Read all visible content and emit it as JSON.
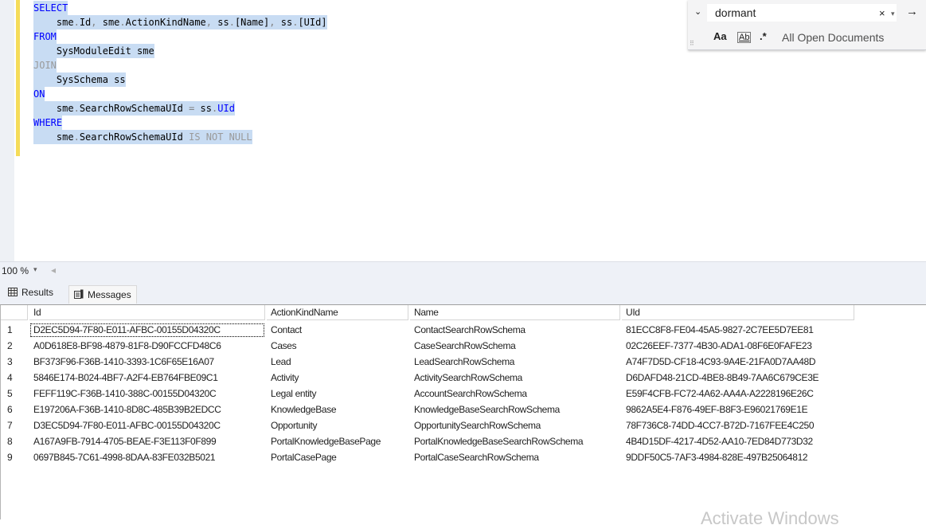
{
  "editor": {
    "lines": [
      {
        "tokens": [
          {
            "t": "SELECT",
            "c": "kw"
          }
        ]
      },
      {
        "tokens": [
          {
            "t": "    sme",
            "c": "ident"
          },
          {
            "t": ".",
            "c": "op"
          },
          {
            "t": "Id",
            "c": "ident"
          },
          {
            "t": ", ",
            "c": "op"
          },
          {
            "t": "sme",
            "c": "ident"
          },
          {
            "t": ".",
            "c": "op"
          },
          {
            "t": "ActionKindName",
            "c": "ident"
          },
          {
            "t": ", ",
            "c": "op"
          },
          {
            "t": "ss",
            "c": "ident"
          },
          {
            "t": ".",
            "c": "op"
          },
          {
            "t": "[Name]",
            "c": "ident"
          },
          {
            "t": ", ",
            "c": "op"
          },
          {
            "t": "ss",
            "c": "ident"
          },
          {
            "t": ".",
            "c": "op"
          },
          {
            "t": "[UId]",
            "c": "ident"
          }
        ]
      },
      {
        "tokens": [
          {
            "t": "FROM",
            "c": "kw"
          }
        ]
      },
      {
        "tokens": [
          {
            "t": "    SysModuleEdit sme",
            "c": "ident"
          }
        ]
      },
      {
        "tokens": [
          {
            "t": "JOIN",
            "c": "grey"
          }
        ]
      },
      {
        "tokens": [
          {
            "t": "    SysSchema ss",
            "c": "ident"
          }
        ]
      },
      {
        "tokens": [
          {
            "t": "ON",
            "c": "kw"
          }
        ]
      },
      {
        "tokens": [
          {
            "t": "    sme",
            "c": "ident"
          },
          {
            "t": ".",
            "c": "op"
          },
          {
            "t": "SearchRowSchemaUId ",
            "c": "ident"
          },
          {
            "t": "=",
            "c": "op"
          },
          {
            "t": " ss",
            "c": "ident"
          },
          {
            "t": ".",
            "c": "op"
          },
          {
            "t": "UId",
            "c": "kw"
          }
        ]
      },
      {
        "tokens": [
          {
            "t": "WHERE",
            "c": "kw"
          }
        ]
      },
      {
        "tokens": [
          {
            "t": "    sme",
            "c": "ident"
          },
          {
            "t": ".",
            "c": "op"
          },
          {
            "t": "SearchRowSchemaUId ",
            "c": "ident"
          },
          {
            "t": "IS NOT NULL",
            "c": "grey"
          }
        ]
      }
    ]
  },
  "find": {
    "term": "dormant",
    "clear_icon": "×",
    "dropdown_icon": "▾",
    "next_icon": "→",
    "chevron_icon": "⌄",
    "match_case": "Aa",
    "whole_word": "Ab",
    "regex": ".*",
    "scope": "All Open Documents",
    "grip_icon": "⠿"
  },
  "zoom": {
    "level": "100 %",
    "dropdown_icon": "▾",
    "scroll_left_icon": "◂"
  },
  "tabs": {
    "results": "Results",
    "messages": "Messages"
  },
  "results": {
    "columns": [
      "",
      "Id",
      "ActionKindName",
      "Name",
      "UId"
    ],
    "rows": [
      [
        "1",
        "D2EC5D94-7F80-E011-AFBC-00155D04320C",
        "Contact",
        "ContactSearchRowSchema",
        "81ECC8F8-FE04-45A5-9827-2C7EE5D7EE81"
      ],
      [
        "2",
        "A0D618E8-BF98-4879-81F8-D90FCCFD48C6",
        "Cases",
        "CaseSearchRowSchema",
        "02C26EEF-7377-4B30-ADA1-08F6E0FAFE23"
      ],
      [
        "3",
        "BF373F96-F36B-1410-3393-1C6F65E16A07",
        "Lead",
        "LeadSearchRowSchema",
        "A74F7D5D-CF18-4C93-9A4E-21FA0D7AA48D"
      ],
      [
        "4",
        "5846E174-B024-4BF7-A2F4-EB764FBE09C1",
        "Activity",
        "ActivitySearchRowSchema",
        "D6DAFD48-21CD-4BE8-8B49-7AA6C679CE3E"
      ],
      [
        "5",
        "FEFF119C-F36B-1410-388C-00155D04320C",
        "Legal entity",
        "AccountSearchRowSchema",
        "E59F4CFB-FC72-4A62-AA4A-A2228196E26C"
      ],
      [
        "6",
        "E197206A-F36B-1410-8D8C-485B39B2EDCC",
        "KnowledgeBase",
        "KnowledgeBaseSearchRowSchema",
        "9862A5E4-F876-49EF-B8F3-E96021769E1E"
      ],
      [
        "7",
        "D3EC5D94-7F80-E011-AFBC-00155D04320C",
        "Opportunity",
        "OpportunitySearchRowSchema",
        "78F736C8-74DD-4CC7-B72D-7167FEE4C250"
      ],
      [
        "8",
        "A167A9FB-7914-4705-BEAE-F3E113F0F899",
        "PortalKnowledgeBasePage",
        "PortalKnowledgeBaseSearchRowSchema",
        "4B4D15DF-4217-4D52-AA10-7ED84D773D32"
      ],
      [
        "9",
        "0697B845-7C61-4998-8DAA-83FE032B5021",
        "PortalCasePage",
        "PortalCaseSearchRowSchema",
        "9DDF50C5-7AF3-4984-828E-497B25064812"
      ]
    ]
  },
  "watermark": "Activate Windows",
  "colors": {
    "keyword": "#0000ff",
    "selection": "#c8dcf3",
    "changebar": "#f5dc59"
  }
}
